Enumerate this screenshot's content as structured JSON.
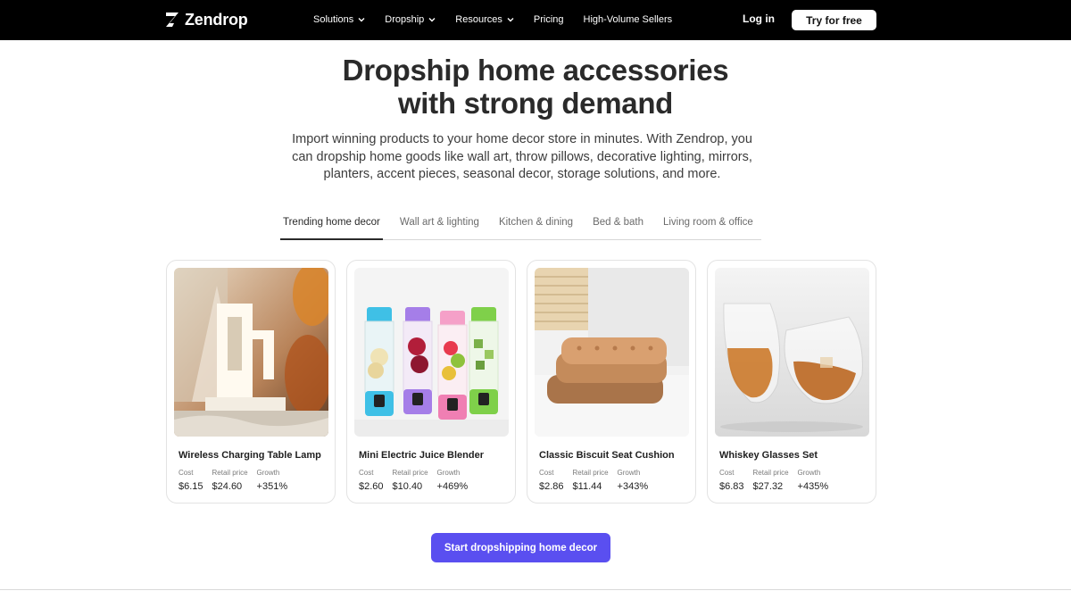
{
  "brand": {
    "name": "Zendrop"
  },
  "nav": {
    "links": [
      {
        "label": "Solutions",
        "has_dropdown": true
      },
      {
        "label": "Dropship",
        "has_dropdown": true
      },
      {
        "label": "Resources",
        "has_dropdown": true
      },
      {
        "label": "Pricing",
        "has_dropdown": false
      },
      {
        "label": "High-Volume Sellers",
        "has_dropdown": false
      }
    ],
    "login_label": "Log in",
    "try_label": "Try for free"
  },
  "hero": {
    "title_line1": "Dropship home accessories",
    "title_line2": "with strong demand",
    "subtitle": "Import winning products to your home decor store in minutes. With Zendrop, you can dropship home goods like wall art, throw pillows, decorative lighting, mirrors, planters, accent pieces, seasonal decor, storage solutions, and more."
  },
  "tabs": [
    {
      "label": "Trending home decor",
      "active": true
    },
    {
      "label": "Wall art & lighting",
      "active": false
    },
    {
      "label": "Kitchen & dining",
      "active": false
    },
    {
      "label": "Bed & bath",
      "active": false
    },
    {
      "label": "Living room & office",
      "active": false
    }
  ],
  "stat_labels": {
    "cost": "Cost",
    "retail": "Retail price",
    "growth": "Growth"
  },
  "products": [
    {
      "name": "Wireless Charging Table Lamp",
      "cost": "$6.15",
      "retail": "$24.60",
      "growth": "+351%"
    },
    {
      "name": "Mini Electric Juice Blender",
      "cost": "$2.60",
      "retail": "$10.40",
      "growth": "+469%"
    },
    {
      "name": "Classic Biscuit Seat Cushion",
      "cost": "$2.86",
      "retail": "$11.44",
      "growth": "+343%"
    },
    {
      "name": "Whiskey Glasses Set",
      "cost": "$6.83",
      "retail": "$27.32",
      "growth": "+435%"
    }
  ],
  "cta": {
    "label": "Start dropshipping home decor"
  },
  "colors": {
    "nav_bg": "#000000",
    "cta_bg": "#5a4ff0",
    "text": "#2a2a2a"
  }
}
